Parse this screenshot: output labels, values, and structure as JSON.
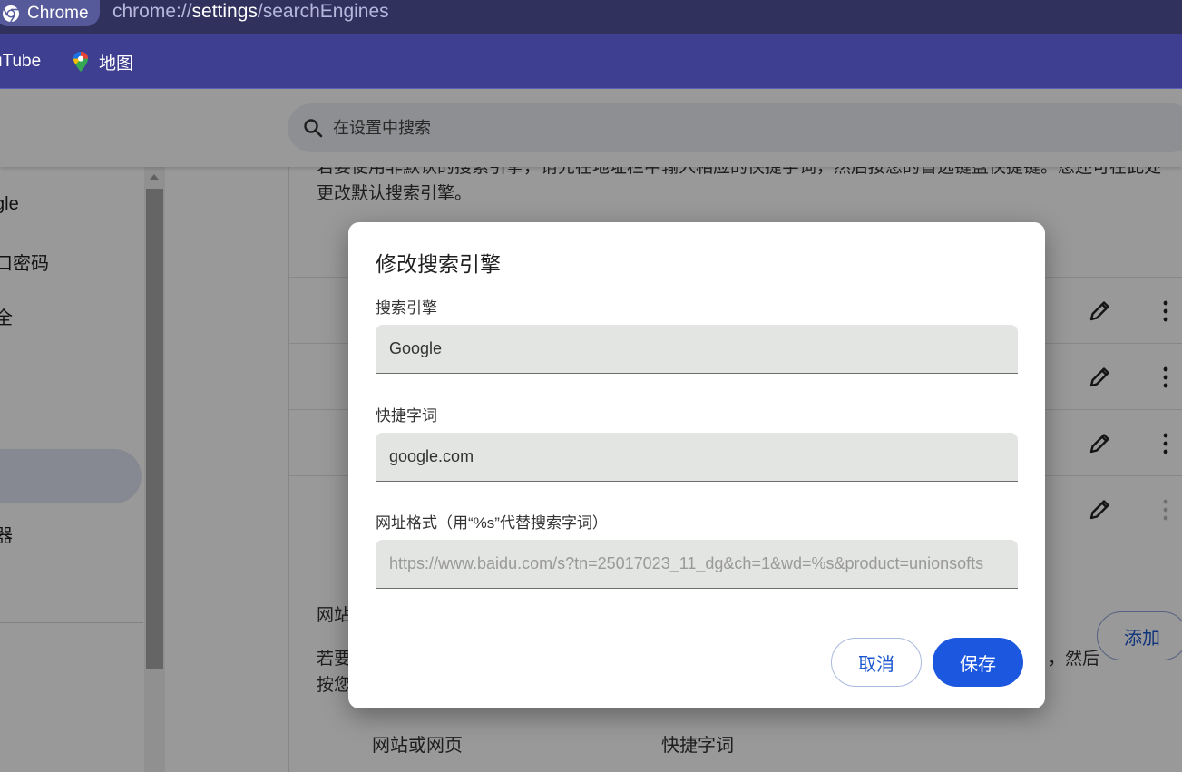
{
  "browser": {
    "chip_label": "Chrome",
    "url_scheme": "chrome://",
    "url_host": "settings",
    "url_path": "/searchEngines"
  },
  "bookmarks": [
    {
      "label": "uTube",
      "icon": "youtube-icon"
    },
    {
      "label": "地图",
      "icon": "maps-pin-icon"
    }
  ],
  "settings": {
    "search_placeholder": "在设置中搜索",
    "sidebar_items": [
      "gle",
      "口密码",
      "全",
      "器"
    ],
    "intro_line1": "若要使用非默认的搜索引擎，请先在地址栏中输入相应的快捷字词，然后按您的首选键盘快捷键。您还可在此处",
    "intro_line2": "更改默认搜索引擎。",
    "site_search_heading": "网站",
    "site_search_text1": "若要",
    "site_search_text1_end": "，然后",
    "site_search_text2": "按您",
    "add_button": "添加",
    "table_headers": {
      "site": "网站或网页",
      "shortcut": "快捷字词"
    }
  },
  "dialog": {
    "title": "修改搜索引擎",
    "engine_label": "搜索引擎",
    "engine_value": "Google",
    "shortcut_label": "快捷字词",
    "shortcut_value": "google.com",
    "url_label": "网址格式（用“%s”代替搜索字词）",
    "url_placeholder": "https://www.baidu.com/s?tn=25017023_11_dg&ch=1&wd=%s&product=unionsofts",
    "cancel_label": "取消",
    "save_label": "保存"
  },
  "colors": {
    "accent": "#1c57df",
    "topbar": "#31315e",
    "bookmark_bar": "#3f3f91"
  }
}
